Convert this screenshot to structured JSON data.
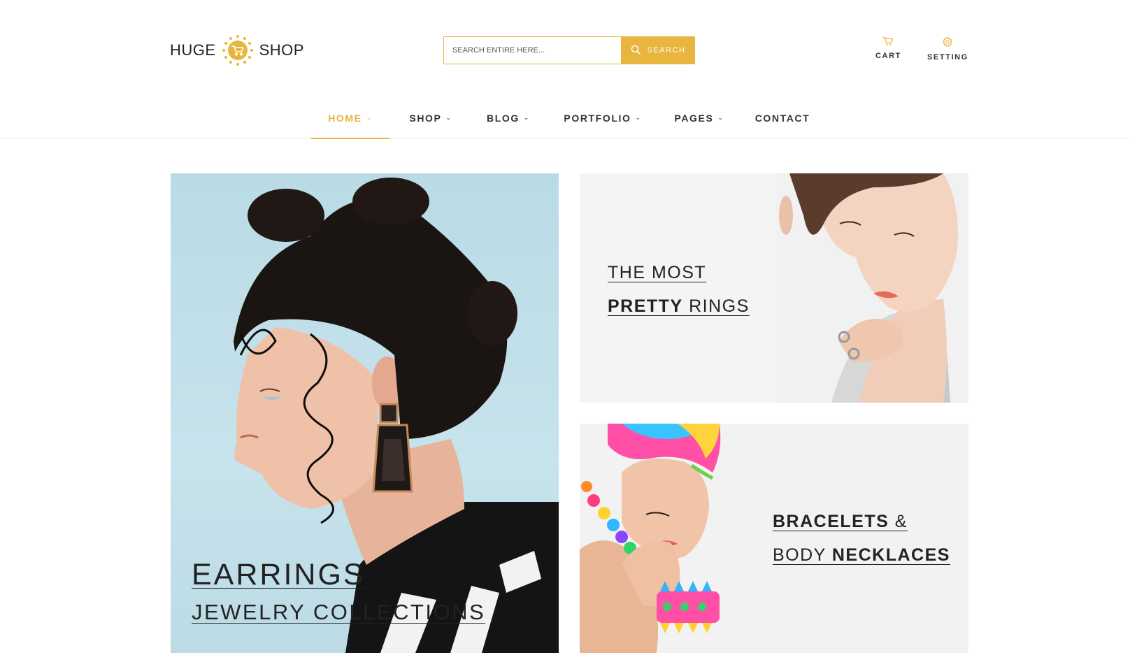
{
  "brand": {
    "name_left": "HUGE",
    "name_right": "SHOP",
    "accent_color": "#e8b53f",
    "logo_icon": "cart-badge-icon"
  },
  "search": {
    "placeholder": "SEARCH ENTIRE HERE...",
    "button_label": "SEARCH",
    "button_icon": "search-icon"
  },
  "header_actions": {
    "cart_label": "CART",
    "cart_icon": "cart-icon",
    "setting_label": "SETTING",
    "setting_icon": "gear-icon"
  },
  "nav": {
    "items": [
      {
        "label": "HOME",
        "has_dropdown": true,
        "active": true
      },
      {
        "label": "SHOP",
        "has_dropdown": true,
        "active": false
      },
      {
        "label": "BLOG",
        "has_dropdown": true,
        "active": false
      },
      {
        "label": "PORTFOLIO",
        "has_dropdown": true,
        "active": false
      },
      {
        "label": "PAGES",
        "has_dropdown": true,
        "active": false
      },
      {
        "label": "CONTACT",
        "has_dropdown": false,
        "active": false
      }
    ],
    "dropdown_icon": "chevron-down-icon"
  },
  "banners": {
    "earrings": {
      "title": "EARRINGS",
      "subtitle": "JEWELRY COLLECTIONS"
    },
    "rings": {
      "line1": "THE MOST",
      "line2_bold": "PRETTY",
      "line2_thin": "RINGS"
    },
    "necklaces": {
      "line1_bold": "BRACELETS",
      "line1_thin": "&",
      "line2_thin": "BODY",
      "line2_bold": "NECKLACES"
    }
  }
}
